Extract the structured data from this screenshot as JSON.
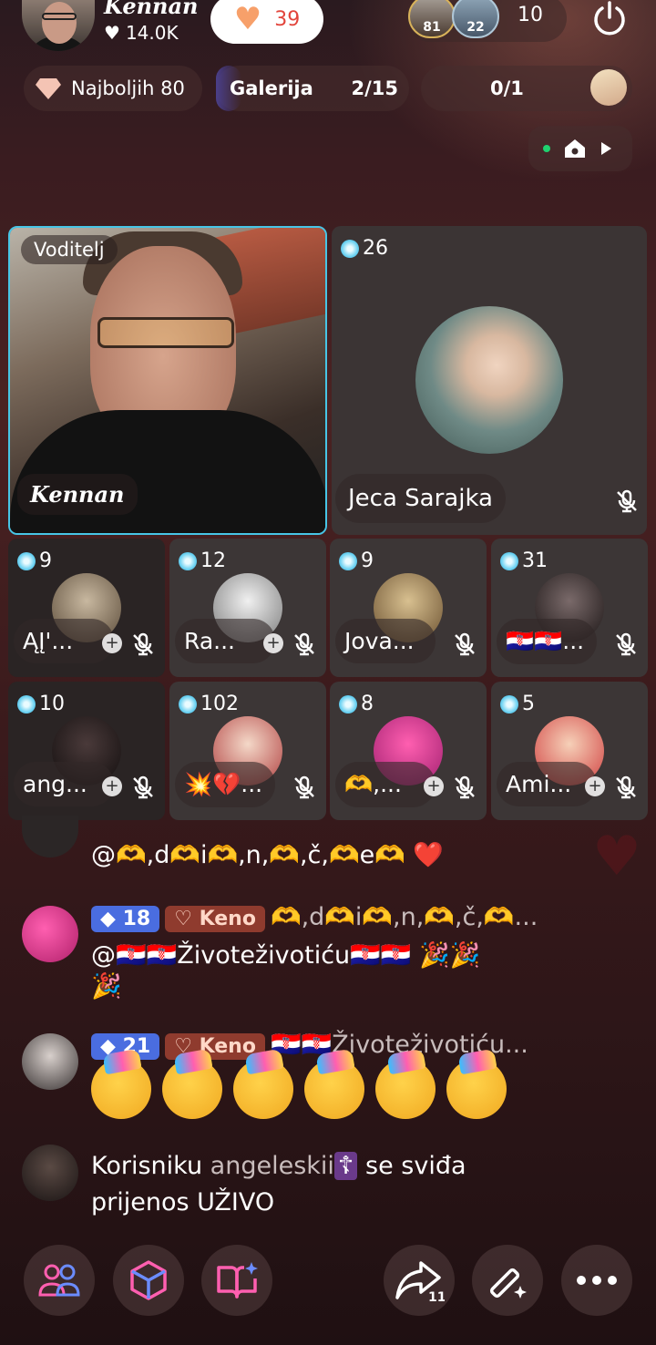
{
  "host": {
    "name": "Kennan",
    "likes": "14.0K",
    "heart_count": "39"
  },
  "viewers": {
    "badge1": "81",
    "badge2": "22",
    "total": "10"
  },
  "rank": {
    "label": "Najboljih 80"
  },
  "gallery": {
    "label": "Galerija",
    "count": "2/15",
    "progress": 0.13
  },
  "seats": {
    "count": "0/1"
  },
  "host_tile": {
    "role_label": "Voditelj",
    "name": "Kennan"
  },
  "guest_main": {
    "level": "26",
    "name": "Jeca Sarajka"
  },
  "guests": [
    {
      "level": "9",
      "name": "ĄĮ'..."
    },
    {
      "level": "12",
      "name": "Ra..."
    },
    {
      "level": "9",
      "name": "Jova..."
    },
    {
      "level": "31",
      "name": "🇭🇷🇭🇷..."
    },
    {
      "level": "10",
      "name": "ang..."
    },
    {
      "level": "102",
      "name": "💥💔..."
    },
    {
      "level": "8",
      "name": "🫶,..."
    },
    {
      "level": "5",
      "name": "Ami..."
    }
  ],
  "chat": [
    {
      "text": "@🫶,d🫶i🫶,n,🫶,č,🫶e🫶 ❤️"
    },
    {
      "level": "18",
      "tag": "Keno",
      "user": "🫶,d🫶i🫶,n,🫶,č,🫶...",
      "text": "@🇭🇷🇭🇷Životeživotiću🇭🇷🇭🇷 🎉🎉",
      "text2": "🎉"
    },
    {
      "level": "21",
      "tag": "Keno",
      "user": "🇭🇷🇭🇷Životeživotiću..."
    },
    {
      "text_pre": "Korisniku ",
      "user": "angeleskii",
      "text_post": " se sviđa",
      "text2": "prijenos UŽIVO"
    }
  ],
  "share_count": "11"
}
